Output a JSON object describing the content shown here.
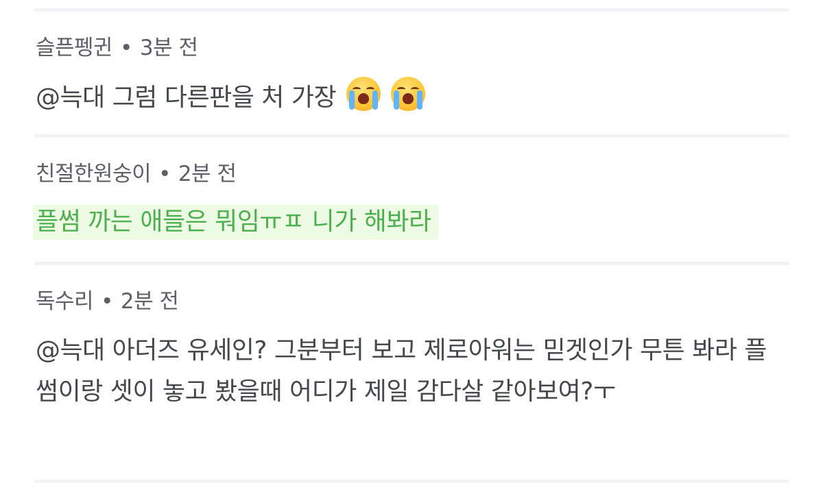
{
  "comments": [
    {
      "author": "슬픈펭귄",
      "time": "3분 전",
      "text": "@늑대 그럼 다른판을 처 가장",
      "emojis": [
        "loudly-crying-face",
        "loudly-crying-face"
      ]
    },
    {
      "author": "친절한원숭이",
      "time": "2분 전",
      "text": "플썸 까는 애들은 뭐임ㅠㅍ 니가 해봐라",
      "highlighted": true,
      "highlight_color": "#eefbe4",
      "text_color": "#4caf50"
    },
    {
      "author": "독수리",
      "time": "2분 전",
      "text": "@늑대 아더즈 유세인? 그분부터 보고 제로아워는 믿겟인가 무튼 봐라 플썸이랑 셋이 놓고 봤을때 어디가 제일 감다살 같아보여?ㅜ"
    }
  ],
  "separator": "•"
}
